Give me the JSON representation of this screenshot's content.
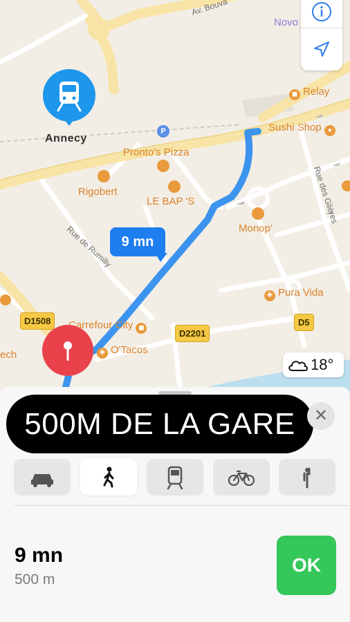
{
  "map": {
    "station": {
      "name": "Annecy"
    },
    "eta_bubble": "9 mn",
    "pois": [
      {
        "name": "Relay"
      },
      {
        "name": "Sushi Shop"
      },
      {
        "name": "Pronto's Pizza"
      },
      {
        "name": "Rigobert"
      },
      {
        "name": "LE BAP 'S"
      },
      {
        "name": "Monop'"
      },
      {
        "name": "Pura Vida"
      },
      {
        "name": "Carrefour City"
      },
      {
        "name": "O'Tacos"
      },
      {
        "name": "Novo"
      },
      {
        "name": "ech"
      }
    ],
    "streets": [
      "Av. Bouva",
      "Rue de Rumilly",
      "Rue des Glières"
    ],
    "road_badges": [
      "D1508",
      "D2201",
      "D5"
    ],
    "weather": {
      "temp": "18°",
      "icon": "cloud-icon"
    },
    "controls": [
      {
        "icon": "info-icon"
      },
      {
        "icon": "location-arrow-icon"
      }
    ],
    "colors": {
      "route": "#2d8cf0",
      "station": "#1e96ec",
      "destination": "#e9424b",
      "poi": "#d9822b"
    }
  },
  "sheet": {
    "caption": "500M DE LA GARE",
    "transport_modes": [
      {
        "name": "car",
        "icon": "car-icon",
        "selected": false
      },
      {
        "name": "walk",
        "icon": "walk-icon",
        "selected": true
      },
      {
        "name": "transit",
        "icon": "train-icon",
        "selected": false
      },
      {
        "name": "bike",
        "icon": "bicycle-icon",
        "selected": false
      },
      {
        "name": "rideshare",
        "icon": "person-waving-icon",
        "selected": false
      }
    ],
    "duration": "9 mn",
    "distance": "500 m",
    "ok_label": "OK",
    "colors": {
      "ok": "#34c759"
    }
  }
}
